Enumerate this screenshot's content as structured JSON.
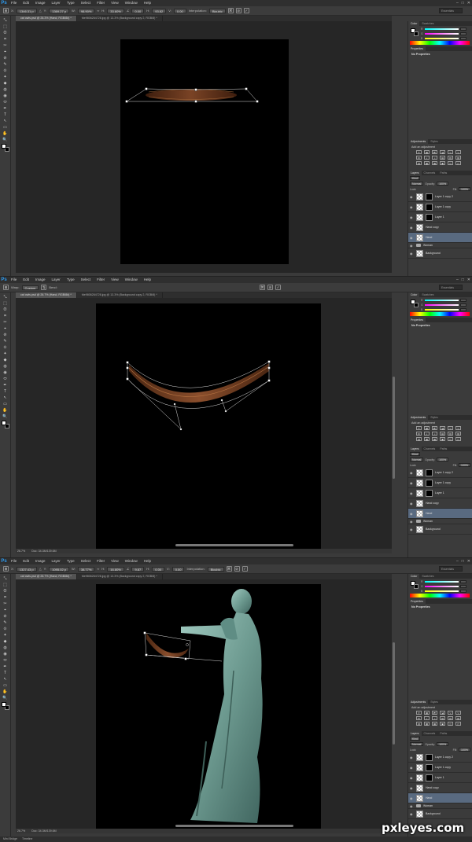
{
  "app": {
    "logo": "Ps",
    "menu": [
      "File",
      "Edit",
      "Image",
      "Layer",
      "Type",
      "Select",
      "Filter",
      "View",
      "Window",
      "Help"
    ],
    "window_controls": [
      "–",
      "□",
      "✕"
    ],
    "workspace": "Essentials"
  },
  "shot1": {
    "options": [
      {
        "label": "X:",
        "value": "1346.31 p"
      },
      {
        "label": "Y:",
        "value": "1369.27 p"
      },
      {
        "label": "W:",
        "value": "98.90%"
      },
      {
        "label": "H:",
        "value": "33.60%"
      },
      {
        "label": "",
        "value": "0.00"
      },
      {
        "label": "H:",
        "value": "93.82"
      },
      {
        "label": "V:",
        "value": "0.00"
      }
    ],
    "interpolation_label": "Interpolation:",
    "interpolation_value": "Bicubic",
    "tabs": [
      "cat owls.psd @ 26.3% (Hand, RGB/8#) *",
      "fde9806264728.jpg @ 13.3% (Background copy 2, RGB/8) *"
    ]
  },
  "shot2": {
    "warp_label": "Warp:",
    "warp_value": "Custom",
    "bend_label": "Bend:",
    "bend_value": "",
    "tabs": [
      "cat owls.psd @ 26.7% (Hand, RGB/8#) *",
      "fde9806264728.jpg @ 13.3% (Background copy 2, RGB/8) *"
    ],
    "zoom": "26.7%",
    "doc_size": "Doc: 34.3M/139.6M"
  },
  "shot3": {
    "options": [
      {
        "label": "X:",
        "value": "1327.43 p"
      },
      {
        "label": "Y:",
        "value": "1095.02 p"
      },
      {
        "label": "W:",
        "value": "38.77%"
      },
      {
        "label": "H:",
        "value": "16.80%"
      },
      {
        "label": "",
        "value": "9.87"
      },
      {
        "label": "H:",
        "value": "0.00"
      },
      {
        "label": "V:",
        "value": "0.00"
      }
    ],
    "interpolation_label": "Interpolation:",
    "interpolation_value": "Bicubic",
    "tabs": [
      "cat owls.psd @ 26.7% (Hand, RGB/8#) *",
      "fde9806264728.jpg @ 13.3% (Background copy 2, RGB/8) *"
    ],
    "zoom": "26.7%",
    "doc_size": "Doc: 34.3M/139.6M",
    "bottom_tabs": [
      "Mini Bridge",
      "Timeline"
    ]
  },
  "panels": {
    "color_tabs": [
      "Color",
      "Swatches"
    ],
    "color_letters": [
      "R",
      "G",
      "B"
    ],
    "props_tabs": [
      "Properties"
    ],
    "props_text": "No Properties",
    "adj_tabs": [
      "Adjustments",
      "Styles"
    ],
    "adj_title": "Add an adjustment",
    "adj_icons": [
      "☀",
      "▦",
      "◩",
      "◪",
      "▽",
      "▽",
      "⚖",
      "◐",
      "◑",
      "▤",
      "▥",
      "▧",
      "▨",
      "▩",
      "▦",
      "▣",
      "◫",
      "◰"
    ],
    "layers_tabs": [
      "Layers",
      "Channels",
      "Paths"
    ],
    "kind": "Kind",
    "blend": "Normal",
    "opacity_label": "Opacity:",
    "opacity": "100%",
    "lock_label": "Lock:",
    "fill_label": "Fill:",
    "fill": "100%",
    "layers": [
      {
        "name": "Layer 1 copy 2",
        "thumb": "checker",
        "mask": true,
        "sel": false
      },
      {
        "name": "Layer 1 copy",
        "thumb": "checker",
        "mask": true,
        "sel": false
      },
      {
        "name": "Layer 1",
        "thumb": "checker",
        "mask": true,
        "sel": false
      },
      {
        "name": "Hand copy",
        "thumb": "checker",
        "mask": false,
        "sel": false
      },
      {
        "name": "Hand",
        "thumb": "checker",
        "mask": false,
        "sel": true
      },
      {
        "name": "Woman",
        "thumb": "folder",
        "mask": false,
        "sel": false
      },
      {
        "name": "Background",
        "thumb": "checker",
        "mask": false,
        "sel": false
      }
    ]
  },
  "tools": [
    "⤡",
    "⬚",
    "ʘ",
    "⌗",
    "✂",
    "⌖",
    "⊘",
    "✎",
    "⊙",
    "✦",
    "◆",
    "◍",
    "◉",
    "⬭",
    "✒",
    "T",
    "↖",
    "▭",
    "✋",
    "🔍"
  ],
  "watermark": "pxleyes.com"
}
